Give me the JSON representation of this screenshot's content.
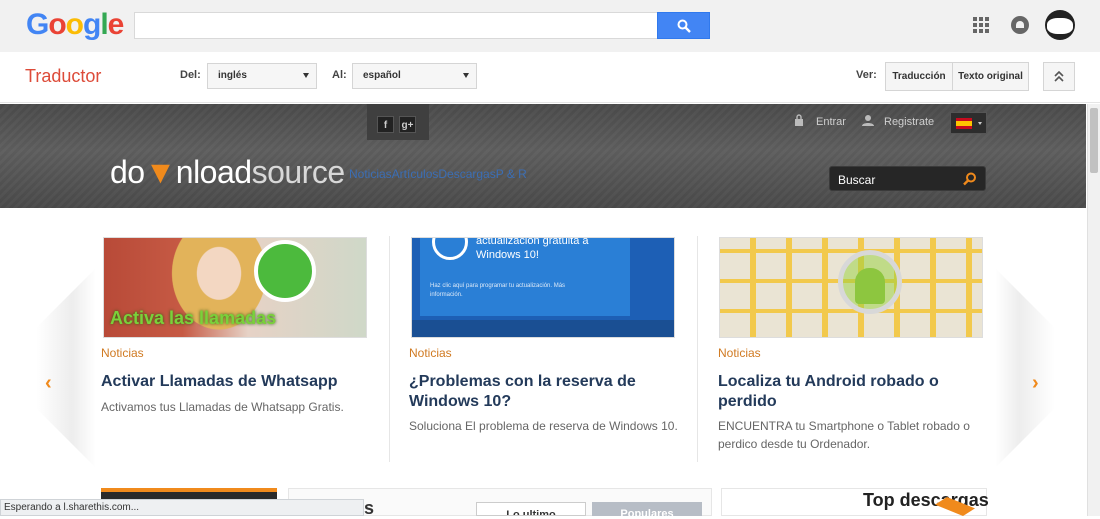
{
  "google_bar": {
    "logo_letters": [
      {
        "char": "G",
        "color": "#4285f4"
      },
      {
        "char": "o",
        "color": "#ea4335"
      },
      {
        "char": "o",
        "color": "#fbbc05"
      },
      {
        "char": "g",
        "color": "#4285f4"
      },
      {
        "char": "l",
        "color": "#34a853"
      },
      {
        "char": "e",
        "color": "#ea4335"
      }
    ],
    "search_value": "",
    "icons": [
      "search-icon",
      "apps-icon",
      "notifications-icon",
      "account-avatar"
    ]
  },
  "translator": {
    "title": "Traductor",
    "from_label": "Del:",
    "from_value": "inglés",
    "to_label": "Al:",
    "to_value": "español",
    "view_label": "Ver:",
    "view_translation": "Traducción",
    "view_original": "Texto original"
  },
  "site": {
    "social": [
      "f",
      "g+"
    ],
    "login": "Entrar",
    "register": "Registrate",
    "logo_prefix": "do",
    "logo_mid": "nload",
    "logo_suffix": "source",
    "nav": "NoticiasArtículosDescargasP & R",
    "search_label": "Buscar"
  },
  "carousel": {
    "prev": "‹",
    "next": "›",
    "cards": [
      {
        "category": "Noticias",
        "title": "Activar Llamadas de Whatsapp",
        "desc": "Activamos tus Llamadas de Whatsapp Gratis.",
        "image_text": "Activa las llamadas"
      },
      {
        "category": "Noticias",
        "title": "¿Problemas con la reserva de Windows 10?",
        "desc": "Soluciona El problema de reserva de Windows 10.",
        "image_text_1": "actualización gratuita a Windows 10!",
        "image_text_2": "Haz clic aquí para programar tu actualización. Más información."
      },
      {
        "category": "Noticias",
        "title": "Localiza tu Android robado o perdido",
        "desc": "ENCUENTRA tu Smartphone o Tablet robado o perdico desde tu Ordenador."
      }
    ]
  },
  "bottom": {
    "block2_heading_tail": "s",
    "tab1": "Lo ultimo",
    "tab2": "Populares",
    "block3_heading": "Top descargas"
  },
  "status_text": "Esperando a l.sharethis.com..."
}
